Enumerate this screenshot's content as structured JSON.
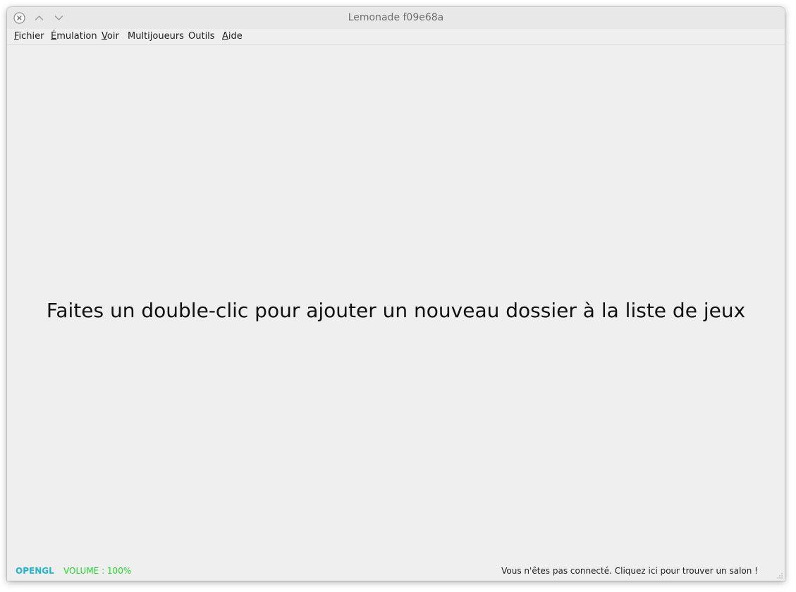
{
  "window": {
    "title": "Lemonade f09e68a"
  },
  "menu": {
    "items": [
      {
        "accel": "F",
        "rest": "ichier"
      },
      {
        "accel": "É",
        "rest": "mulation"
      },
      {
        "accel": "V",
        "rest": "oir"
      },
      {
        "accel": "",
        "rest": "Multijoueurs"
      },
      {
        "accel": "",
        "rest": "Outils"
      },
      {
        "accel": "A",
        "rest": "ide"
      }
    ]
  },
  "content": {
    "placeholder": "Faites un double-clic pour ajouter un nouveau dossier à la liste de jeux"
  },
  "status": {
    "renderer": "OPENGL",
    "volume": "VOLUME : 100%",
    "netplay": "Vous n'êtes pas connecté. Cliquez ici pour trouver un salon !",
    "renderer_color": "#1fb6d6",
    "volume_color": "#1edc2b"
  }
}
